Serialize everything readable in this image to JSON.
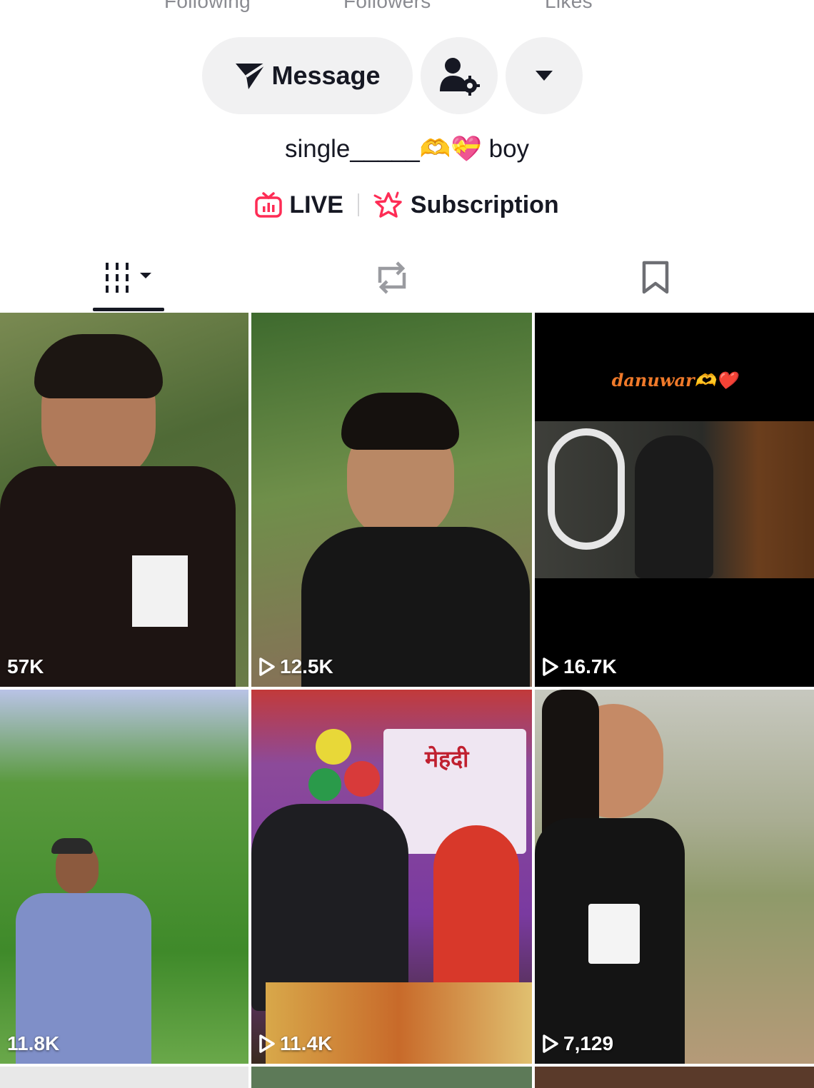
{
  "stats": {
    "following_label": "Following",
    "followers_label": "Followers",
    "likes_label": "Likes"
  },
  "actions": {
    "message_label": "Message"
  },
  "profile": {
    "bio": "single_____🫶💝 boy"
  },
  "links": {
    "live_label": "LIVE",
    "subscription_label": "Subscription"
  },
  "tabs": [
    {
      "name": "videos",
      "icon": "grid-icon"
    },
    {
      "name": "reposts",
      "icon": "repost-icon"
    },
    {
      "name": "favorites",
      "icon": "bookmark-icon"
    }
  ],
  "videos": [
    {
      "views": "57K",
      "play_icon": false
    },
    {
      "views": "12.5K",
      "play_icon": true
    },
    {
      "views": "16.7K",
      "play_icon": true,
      "overlay_text": "danuwar🫶❤️"
    },
    {
      "views": "11.8K",
      "play_icon": false
    },
    {
      "views": "11.4K",
      "play_icon": true,
      "banner_text": "मेहदी"
    },
    {
      "views": "7,129",
      "play_icon": true
    }
  ],
  "colors": {
    "accent_red": "#fe2c55",
    "button_bg": "#f1f1f2",
    "text_primary": "#161823",
    "text_secondary": "#8a8b91"
  }
}
